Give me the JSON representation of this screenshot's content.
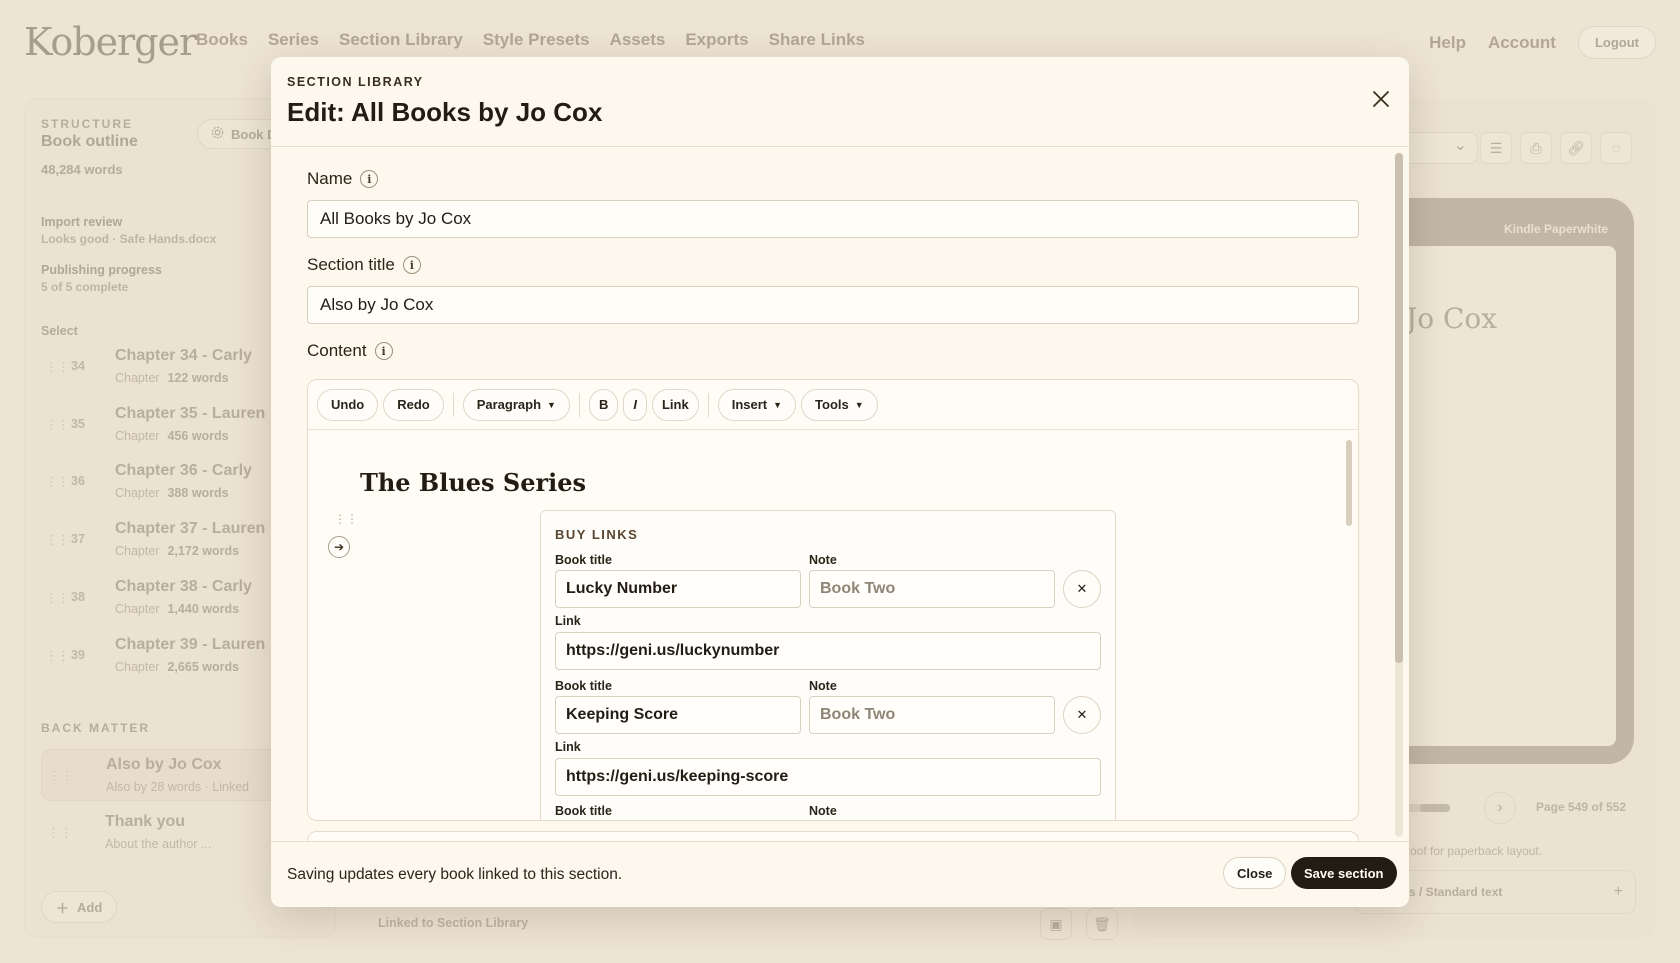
{
  "app": {
    "logo": "Koberger",
    "nav": [
      "Books",
      "Series",
      "Section Library",
      "Style Presets",
      "Assets",
      "Exports",
      "Share Links"
    ],
    "nav_right": {
      "help": "Help",
      "account": "Account",
      "logout": "Logout"
    }
  },
  "sidebar": {
    "structure": "STRUCTURE",
    "outline": "Book outline",
    "words": "48,284 words",
    "book_details": "Book D",
    "import_title": "Import review",
    "import_sub": "Looks good · Safe Hands.docx",
    "progress_title": "Publishing progress",
    "progress_sub": "5 of 5 complete",
    "select": "Select",
    "chapters": [
      {
        "num": "34",
        "title": "Chapter 34 - Carly",
        "kind": "Chapter",
        "words": "122 words"
      },
      {
        "num": "35",
        "title": "Chapter 35 - Lauren",
        "kind": "Chapter",
        "words": "456 words"
      },
      {
        "num": "36",
        "title": "Chapter 36 - Carly",
        "kind": "Chapter",
        "words": "388 words"
      },
      {
        "num": "37",
        "title": "Chapter 37 - Lauren",
        "kind": "Chapter",
        "words": "2,172 words"
      },
      {
        "num": "38",
        "title": "Chapter 38 - Carly",
        "kind": "Chapter",
        "words": "1,440 words"
      },
      {
        "num": "39",
        "title": "Chapter 39 - Lauren",
        "kind": "Chapter",
        "words": "2,665 words"
      }
    ],
    "back_matter": "BACK MATTER",
    "back_items": [
      {
        "title": "Also by Jo Cox",
        "meta": "Also by  28 words · Linked"
      },
      {
        "title": "Thank you",
        "meta": "About the author ..."
      }
    ],
    "add": "Add"
  },
  "preview": {
    "device": "Kindle Paperwhite",
    "screen_title": "Jo Cox",
    "page": "Page 549 of 552",
    "proof_hint": "se Print Proof for paperback layout.",
    "margins": "margins / Standard text"
  },
  "editor_bar": {
    "linked": "Linked to Section Library"
  },
  "modal": {
    "kicker": "SECTION LIBRARY",
    "title": "Edit: All Books by Jo Cox",
    "name_label": "Name",
    "name_value": "All Books by Jo Cox",
    "section_title_label": "Section title",
    "section_title_value": "Also by Jo Cox",
    "content_label": "Content",
    "toolbar": {
      "undo": "Undo",
      "redo": "Redo",
      "paragraph": "Paragraph",
      "bold": "B",
      "italic": "I",
      "link": "Link",
      "insert": "Insert",
      "tools": "Tools"
    },
    "series_heading": "The Blues Series",
    "buy_links": {
      "heading": "BUY LINKS",
      "book_title_label": "Book title",
      "note_label": "Note",
      "link_label": "Link",
      "entries": [
        {
          "title": "Lucky Number",
          "note_placeholder": "Book Two",
          "link": "https://geni.us/luckynumber"
        },
        {
          "title": "Keeping Score",
          "note_placeholder": "Book Two",
          "link": "https://geni.us/keeping-score"
        }
      ]
    },
    "footer_msg": "Saving updates every book linked to this section.",
    "close": "Close",
    "save": "Save section"
  }
}
